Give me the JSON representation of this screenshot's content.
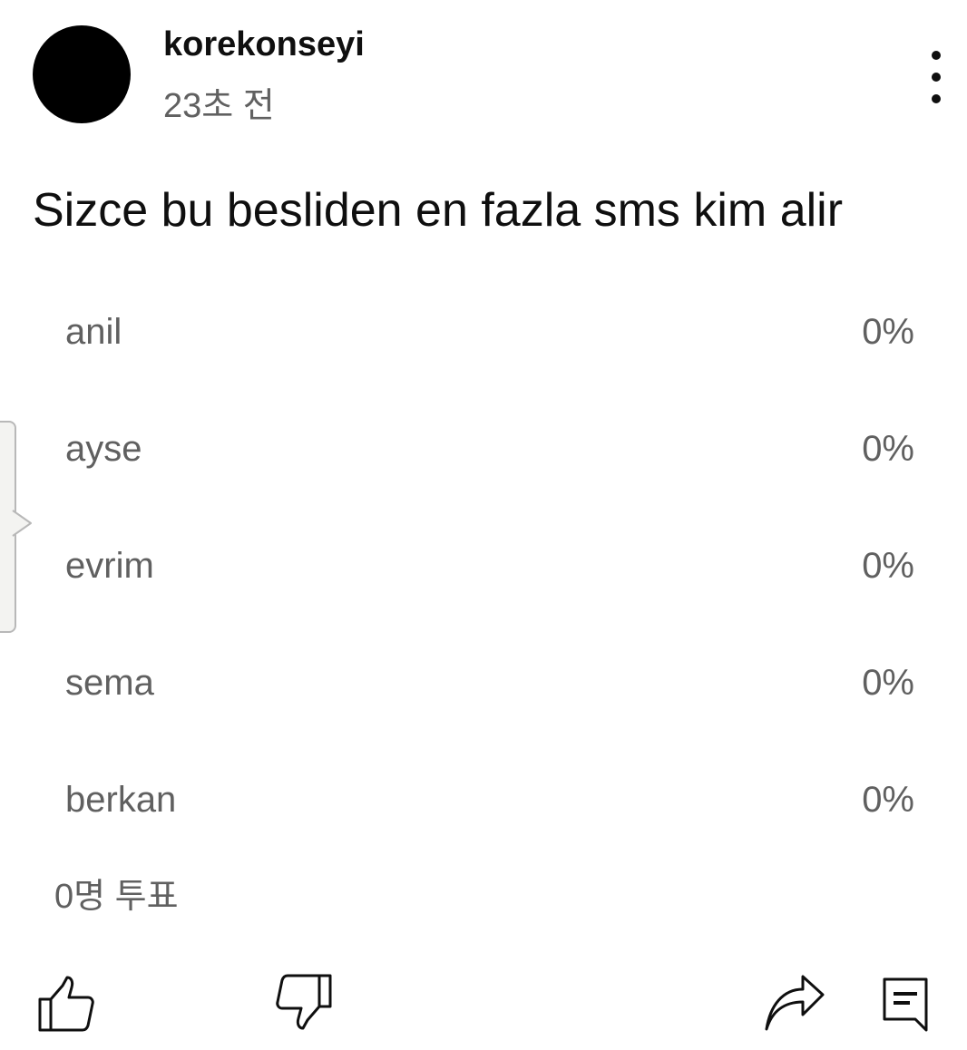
{
  "post": {
    "author": "korekonseyi",
    "timestamp": "23초 전",
    "question": "Sizce bu besliden en fazla sms kim alir"
  },
  "poll": {
    "options": [
      {
        "label": "anil",
        "percent": "0%"
      },
      {
        "label": "ayse",
        "percent": "0%"
      },
      {
        "label": "evrim",
        "percent": "0%"
      },
      {
        "label": "sema",
        "percent": "0%"
      },
      {
        "label": "berkan",
        "percent": "0%"
      }
    ],
    "vote_count": "0명 투표"
  },
  "icons": {
    "more": "more-vert-icon",
    "like": "thumb-up-icon",
    "dislike": "thumb-down-icon",
    "share": "share-icon",
    "comment": "comment-icon"
  },
  "colors": {
    "primary_text": "#0f0f0f",
    "secondary_text": "#606060",
    "background": "#ffffff",
    "avatar": "#000000"
  }
}
